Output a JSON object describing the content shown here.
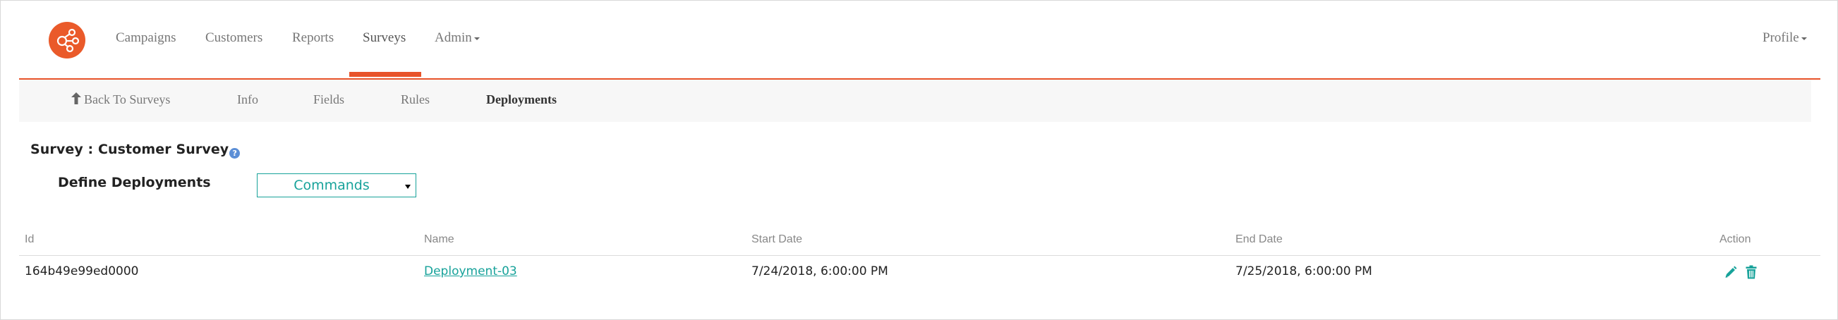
{
  "nav": {
    "logo": "brand-logo",
    "items": [
      {
        "label": "Campaigns"
      },
      {
        "label": "Customers"
      },
      {
        "label": "Reports"
      },
      {
        "label": "Surveys"
      },
      {
        "label": "Admin"
      }
    ],
    "active": "Surveys",
    "profile": "Profile"
  },
  "subnav": {
    "back": "Back To Surveys",
    "tabs": [
      {
        "label": "Info"
      },
      {
        "label": "Fields"
      },
      {
        "label": "Rules"
      },
      {
        "label": "Deployments"
      }
    ],
    "active": "Deployments"
  },
  "survey": {
    "title": "Survey : Customer Survey",
    "help_icon": "?"
  },
  "deployments": {
    "label": "Define Deployments",
    "commands": "Commands"
  },
  "table": {
    "columns": [
      "Id",
      "Name",
      "Start Date",
      "End Date",
      "Action"
    ],
    "rows": [
      {
        "id": "164b49e99ed0000",
        "name": "Deployment-03",
        "start": "7/24/2018, 6:00:00 PM",
        "end": "7/25/2018, 6:00:00 PM"
      }
    ]
  },
  "colors": {
    "accent": "#e8532a",
    "teal": "#17a29a",
    "help": "#5b8ed6"
  }
}
